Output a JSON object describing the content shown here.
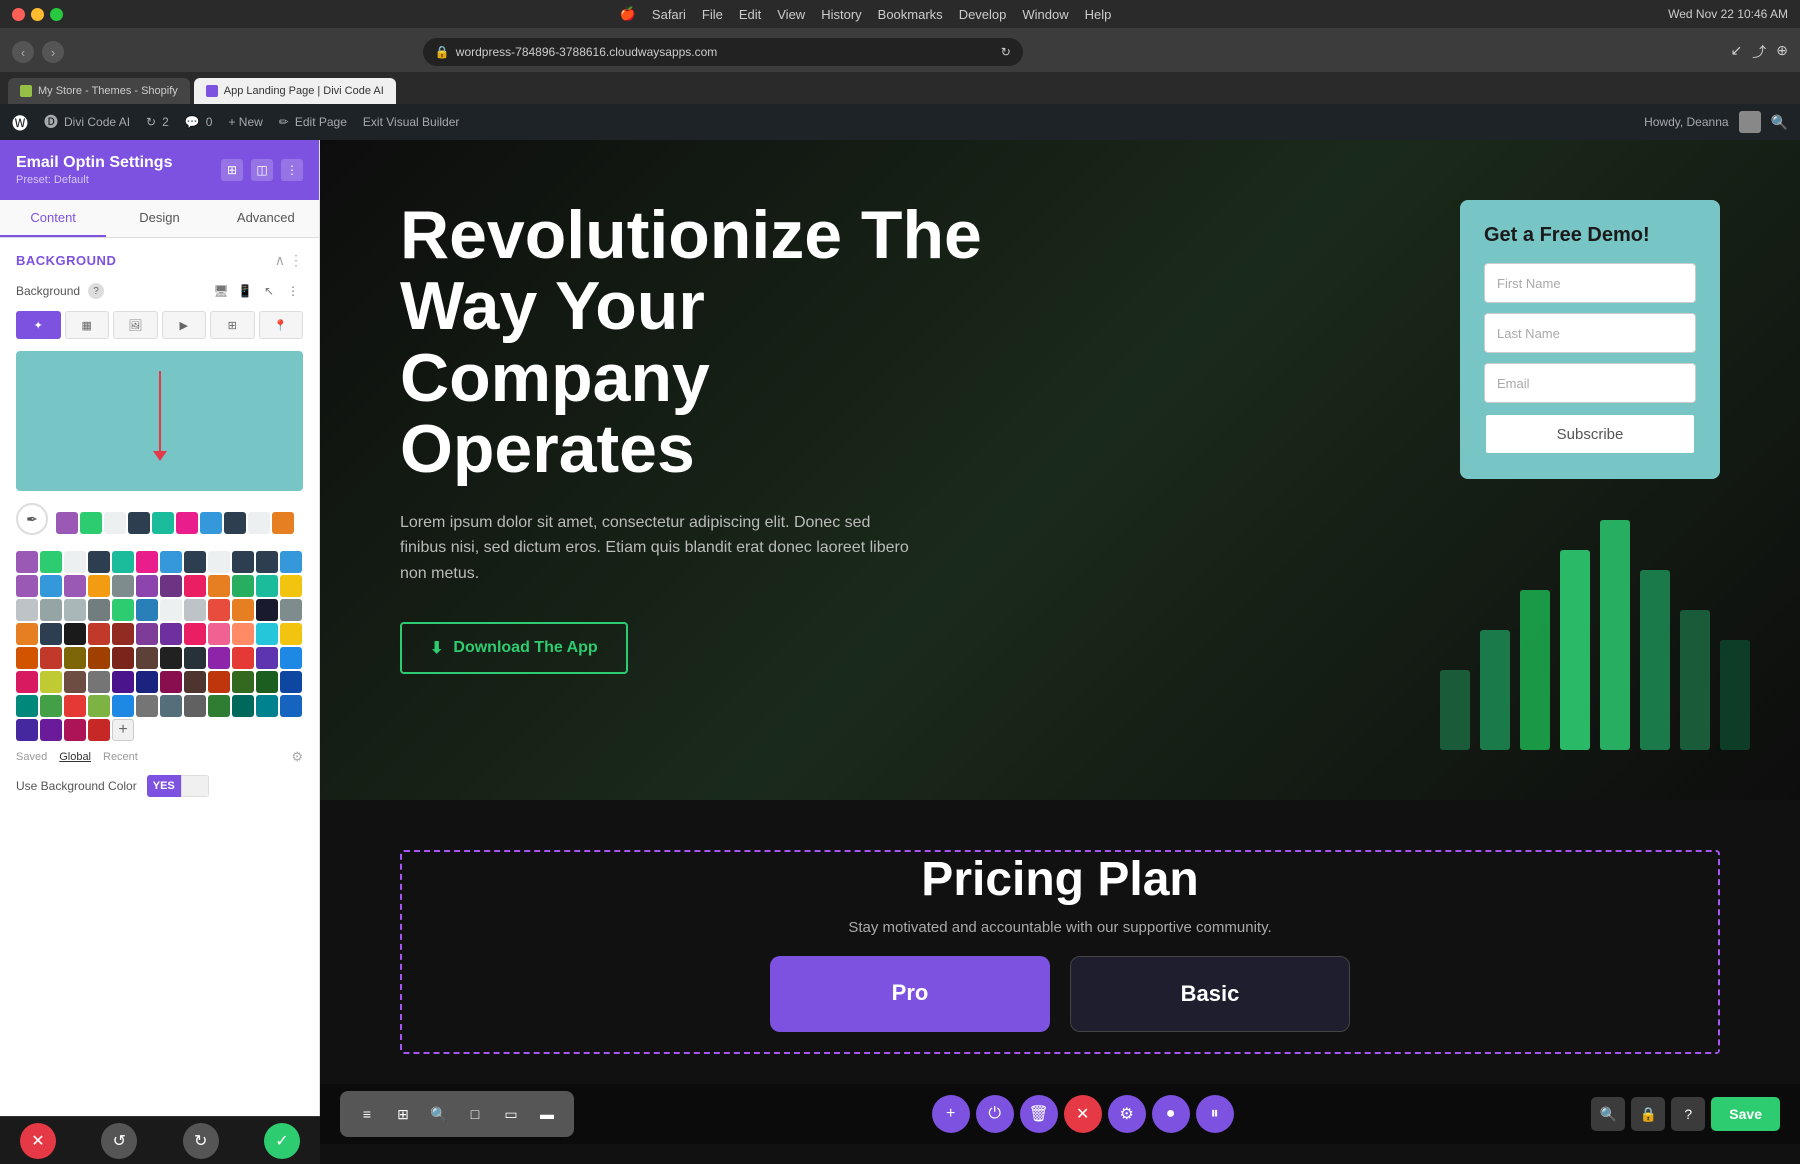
{
  "mac": {
    "menu_items": [
      "Safari",
      "File",
      "Edit",
      "View",
      "History",
      "Bookmarks",
      "Develop",
      "Window",
      "Help"
    ],
    "time": "Wed Nov 22  10:46 AM"
  },
  "browser": {
    "url": "wordpress-784896-3788616.cloudwaysapps.com",
    "tabs": [
      {
        "label": "My Store - Themes - Shopify",
        "active": false
      },
      {
        "label": "App Landing Page | Divi Code AI",
        "active": true
      }
    ],
    "reload_icon": "↻"
  },
  "wp_toolbar": {
    "items": [
      {
        "label": "Divi Code AI"
      },
      {
        "label": "2"
      },
      {
        "label": "0"
      },
      {
        "label": "+ New"
      },
      {
        "label": "Edit Page"
      },
      {
        "label": "Exit Visual Builder"
      }
    ],
    "right": "Howdy, Deanna"
  },
  "sidebar": {
    "title": "Email Optin Settings",
    "preset": "Preset: Default",
    "tabs": [
      "Content",
      "Design",
      "Advanced"
    ],
    "active_tab": "Content",
    "section_title": "Background",
    "bg_label": "Background",
    "bg_types": [
      "gradient",
      "flat",
      "image",
      "video",
      "pattern",
      "map"
    ],
    "palette_tabs": [
      "Saved",
      "Global",
      "Recent"
    ],
    "active_palette": "Global",
    "use_bg_label": "Use Background Color",
    "color_preview_hex": "#78c5c5",
    "swatches": [
      "#9b59b6",
      "#2ecc71",
      "#ecf0f1",
      "#2c3e50",
      "#1abc9c",
      "#e91e8c",
      "#3498db",
      "#2c3e50",
      "#ecf0f1",
      "#2c3e50",
      "#2c3e50",
      "#3498db",
      "#9b59b6",
      "#3498db",
      "#9b59b6",
      "#f39c12",
      "#7f8c8d",
      "#8e44ad",
      "#6c3483",
      "#e91e63",
      "#e67e22",
      "#27ae60",
      "#1abc9c",
      "#f1c40f",
      "#bdc3c7",
      "#95a5a6",
      "#aab7b8",
      "#717d7e",
      "#2ecc71",
      "#2980b9",
      "#ecf0f1",
      "#bdc3c7",
      "#e74c3c",
      "#e67e22",
      "#1a1a2e",
      "#7f8c8d",
      "#e67e22",
      "#2c3e50",
      "#1a1a1a",
      "#c0392b",
      "#922b21",
      "#7d3c98",
      "#6e2f9f",
      "#e91e63",
      "#f06292",
      "#ff8a65",
      "#26c6da",
      "#f1c40f",
      "#d35400",
      "#c0392b",
      "#7d6608",
      "#a04000",
      "#7b241c",
      "#5d4037",
      "#212121",
      "#263238",
      "#8e24aa",
      "#e53935",
      "#5e35b1",
      "#1e88e5",
      "#d81b60",
      "#c0ca33",
      "#6d4c41",
      "#757575",
      "#4a148c",
      "#1a237e",
      "#880e4f",
      "#4e342e",
      "#bf360c",
      "#33691e",
      "#1b5e20",
      "#0d47a1",
      "#00897b",
      "#43a047",
      "#e53935",
      "#7cb342",
      "#1e88e5",
      "#757575",
      "#546e7a",
      "#616161",
      "#2e7d32",
      "#00695c",
      "#00838f",
      "#1565c0",
      "#4527a0",
      "#6a1b9a",
      "#ad1457",
      "#c62828"
    ]
  },
  "hero": {
    "title": "Revolutionize The Way Your Company Operates",
    "body": "Lorem ipsum dolor sit amet, consectetur adipiscing elit. Donec sed finibus nisi, sed dictum eros. Etiam quis blandit erat donec laoreet libero non metus.",
    "btn_label": "Download The App",
    "btn_icon": "⬇"
  },
  "form_card": {
    "title": "Get a Free Demo!",
    "first_name_placeholder": "First Name",
    "last_name_placeholder": "Last Name",
    "email_placeholder": "Email",
    "subscribe_label": "Subscribe"
  },
  "pricing": {
    "title": "Pricing Plan",
    "subtitle": "Stay motivated and accountable with our supportive community.",
    "cards": [
      {
        "label": "Pro"
      },
      {
        "label": "Basic"
      }
    ]
  },
  "bottom_toolbar": {
    "left_tools": [
      "≡",
      "⊞",
      "🔍",
      "□",
      "▭",
      "▬"
    ],
    "center_tools": [
      "+",
      "⏻",
      "🗑",
      "✕",
      "⚙",
      "●",
      "⏸"
    ],
    "right_tools": [
      "🔍",
      "🔒",
      "?"
    ],
    "save_label": "Save"
  }
}
